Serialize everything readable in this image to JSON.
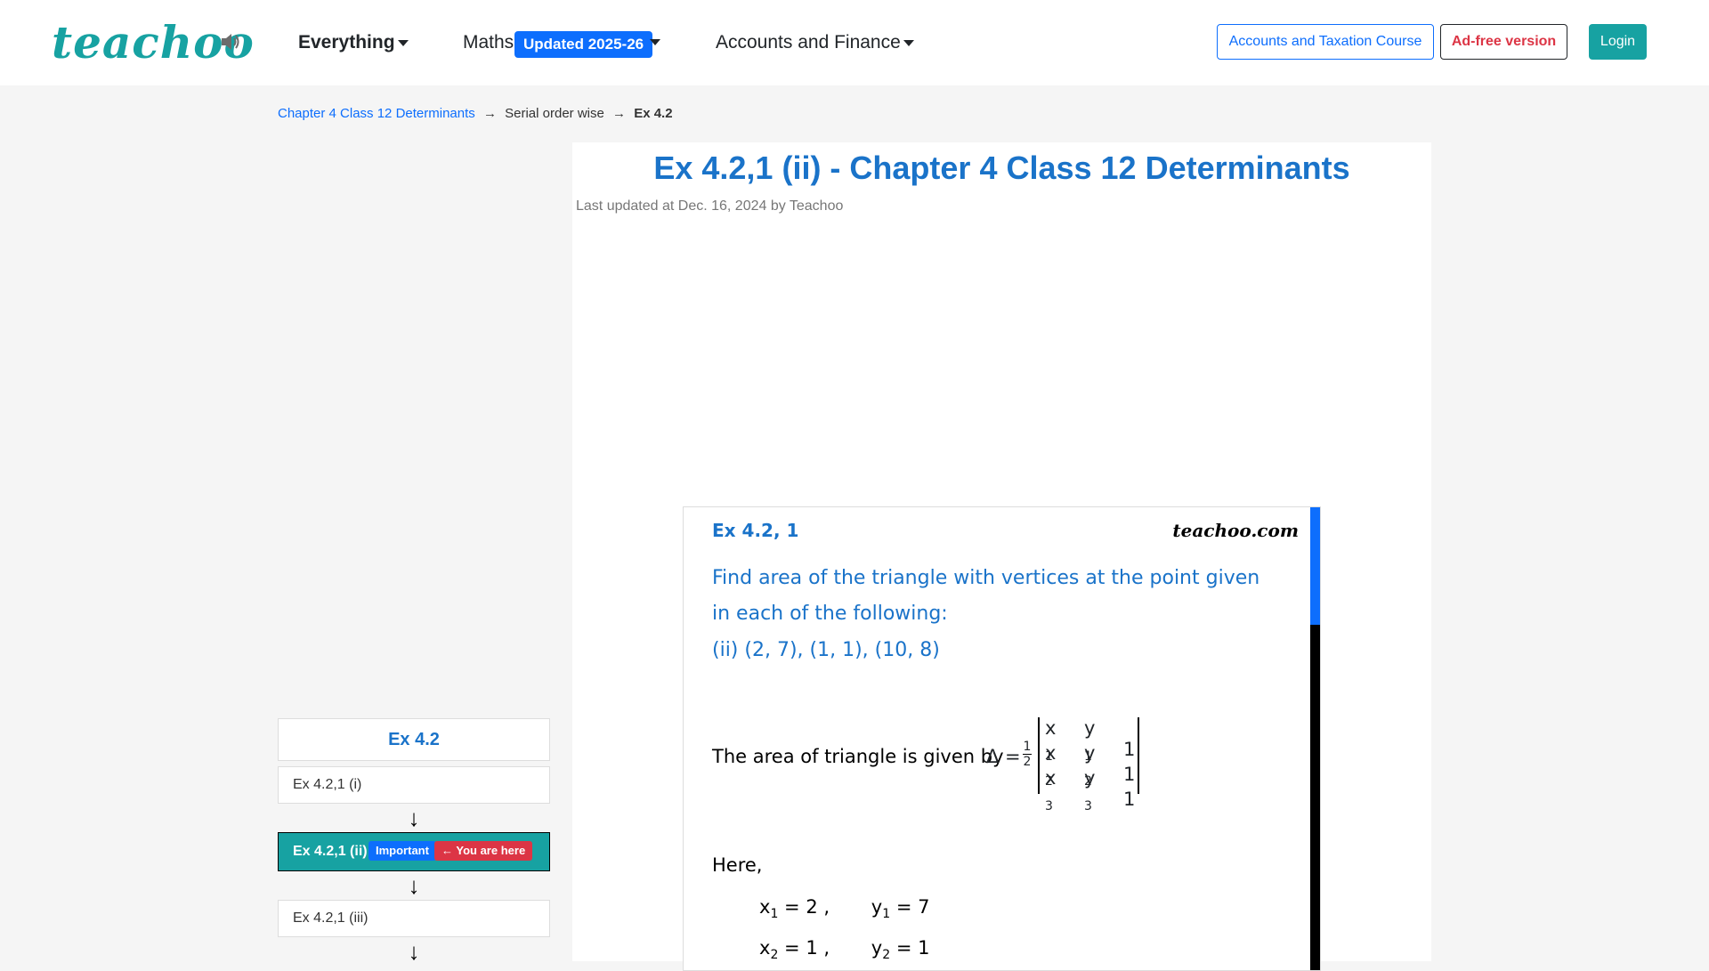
{
  "header": {
    "logo": "teachoo",
    "nav": {
      "everything": "Everything",
      "maths": "Maths",
      "maths_badge": "Updated 2025-26",
      "accounts": "Accounts and Finance"
    },
    "buttons": {
      "course": "Accounts and Taxation Course",
      "adfree": "Ad-free version",
      "login": "Login"
    }
  },
  "breadcrumb": {
    "chapter": "Chapter 4 Class 12 Determinants",
    "sep": "→",
    "section": "Serial order wise",
    "current": "Ex 4.2"
  },
  "article": {
    "title": "Ex 4.2,1 (ii) - Chapter 4 Class 12 Determinants",
    "updated": "Last updated at Dec. 16, 2024 by Teachoo"
  },
  "figure": {
    "heading": "Ex 4.2, 1",
    "brand": "teachoo.com",
    "question": "Find area of the triangle with vertices at the point given in each of the following:",
    "part": "(ii) (2, 7), (1, 1), (10, 8)",
    "area_text": "The area of triangle is given by",
    "delta": "Δ =",
    "frac_num": "1",
    "frac_den": "2",
    "det_rows": [
      {
        "a": "x",
        "a_sub": "1",
        "b": "y",
        "b_sub": "1",
        "c": "1"
      },
      {
        "a": "x",
        "a_sub": "2",
        "b": "y",
        "b_sub": "2",
        "c": "1"
      },
      {
        "a": "x",
        "a_sub": "3",
        "b": "y",
        "b_sub": "3",
        "c": "1"
      }
    ],
    "here": "Here,",
    "x1_line": {
      "x": "x",
      "sub": "1",
      "xval": "= 2 ,",
      "y": "y",
      "ysub": "1",
      "yval": "= 7"
    },
    "x2_line": {
      "x": "x",
      "sub": "2",
      "xval": "= 1 ,",
      "y": "y",
      "ysub": "2",
      "yval": "= 1"
    }
  },
  "sidebar": {
    "heading": "Ex 4.2",
    "items": [
      {
        "label": "Ex 4.2,1 (i)"
      },
      {
        "label": "Ex 4.2,1 (ii)",
        "badge_important": "Important",
        "badge_here": "← You are here"
      },
      {
        "label": "Ex 4.2,1 (iii)"
      }
    ],
    "arrow": "↓"
  }
}
